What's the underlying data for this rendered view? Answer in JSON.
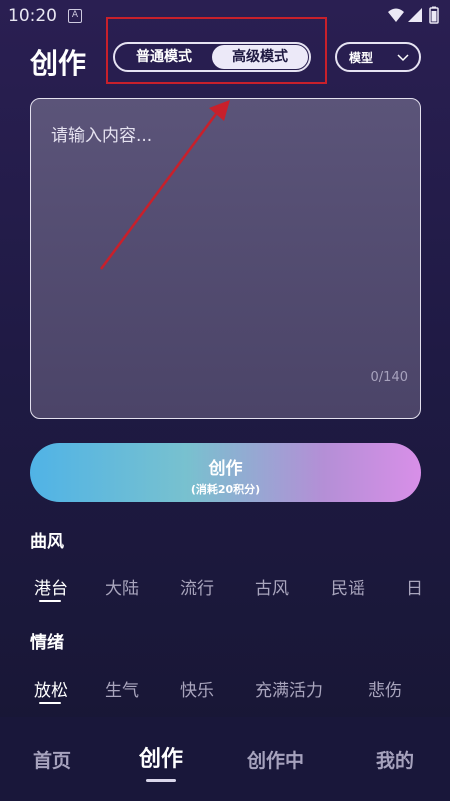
{
  "status_bar": {
    "time": "10:20",
    "notification_glyph": "A"
  },
  "header": {
    "title": "创作",
    "modes": [
      {
        "label": "普通模式",
        "selected": false
      },
      {
        "label": "高级模式",
        "selected": true
      }
    ],
    "model_select": {
      "label": "模型"
    }
  },
  "input": {
    "placeholder": "请输入内容...",
    "counter": "0/140"
  },
  "create_button": {
    "label": "创作",
    "cost": "(消耗20积分)"
  },
  "sections": {
    "style": {
      "title": "曲风",
      "tags": [
        "港台",
        "大陆",
        "流行",
        "古风",
        "民谣",
        "日"
      ],
      "active": "港台"
    },
    "mood": {
      "title": "情绪",
      "tags": [
        "放松",
        "生气",
        "快乐",
        "充满活力",
        "悲伤"
      ],
      "active": "放松"
    }
  },
  "bottom_nav": {
    "items": [
      {
        "label": "首页",
        "active": false
      },
      {
        "label": "创作",
        "active": true
      },
      {
        "label": "创作中",
        "active": false
      },
      {
        "label": "我的",
        "active": false
      }
    ]
  },
  "annotation": {
    "highlight_color": "#c8202b"
  },
  "colors": {
    "accent_gradient_start": "#50b3e6",
    "accent_gradient_end": "#d88fe8",
    "background": "#1f1a44"
  }
}
